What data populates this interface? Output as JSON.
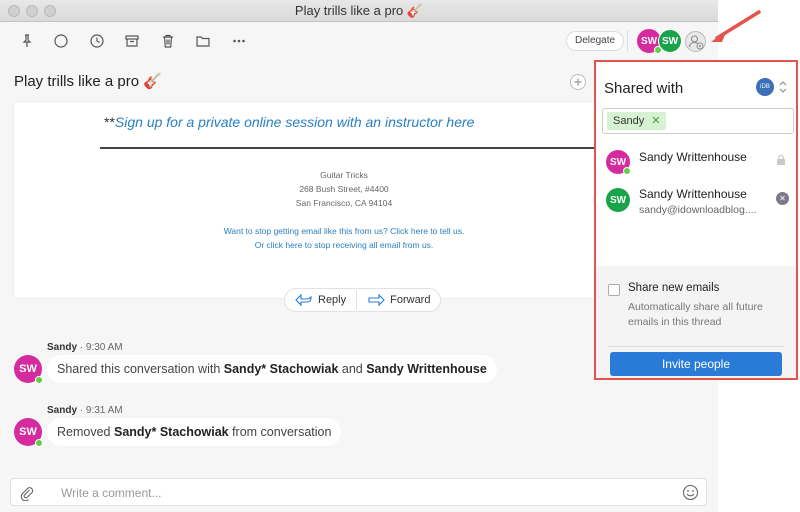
{
  "window": {
    "title": "Play trills like a pro 🎸"
  },
  "toolbar": {
    "delegate_label": "Delegate",
    "avatars": [
      {
        "initials": "SW",
        "color": "#d62a9f"
      },
      {
        "initials": "SW",
        "color": "#19a34a"
      }
    ]
  },
  "email": {
    "subject": "Play trills like a pro 🎸",
    "prefix": "**",
    "signup_link": "Sign up for a private online session with an instructor here",
    "address_lines": [
      "Guitar Tricks",
      "268 Bush Street, #4400",
      "San Francisco, CA 94104"
    ],
    "unsubscribe_lines": [
      "Want to stop getting email like this from us? Click here to tell us.",
      "Or click here to stop receiving all email from us."
    ],
    "reply_label": "Reply",
    "forward_label": "Forward"
  },
  "events": [
    {
      "author": "Sandy",
      "time": "· 9:30 AM",
      "avatar": {
        "initials": "SW",
        "color": "#d62a9f"
      },
      "text_before": "Shared this conversation with ",
      "bold1": "Sandy* Stachowiak",
      "text_mid": " and ",
      "bold2": "Sandy Writtenhouse"
    },
    {
      "author": "Sandy",
      "time": "· 9:31 AM",
      "avatar": {
        "initials": "SW",
        "color": "#d62a9f"
      },
      "text_before": "Removed ",
      "bold1": "Sandy* Stachowiak",
      "text_after": " from conversation"
    }
  ],
  "comment": {
    "placeholder": "Write a comment..."
  },
  "panel": {
    "title": "Shared with",
    "account_badge": "iDB",
    "chip": "Sandy",
    "members": [
      {
        "name": "Sandy Writtenhouse",
        "initials": "SW",
        "color": "#d62a9f",
        "email": ""
      },
      {
        "name": "Sandy Writtenhouse",
        "initials": "SW",
        "color": "#19a34a",
        "email": "sandy@idownloadblog...."
      }
    ],
    "share_new_label": "Share new emails",
    "share_new_desc": "Automatically share all future emails in this thread",
    "invite_label": "Invite people"
  },
  "colors": {
    "accent": "#2a7bd8",
    "highlight_border": "#e5534b",
    "link": "#2a7fc1"
  }
}
